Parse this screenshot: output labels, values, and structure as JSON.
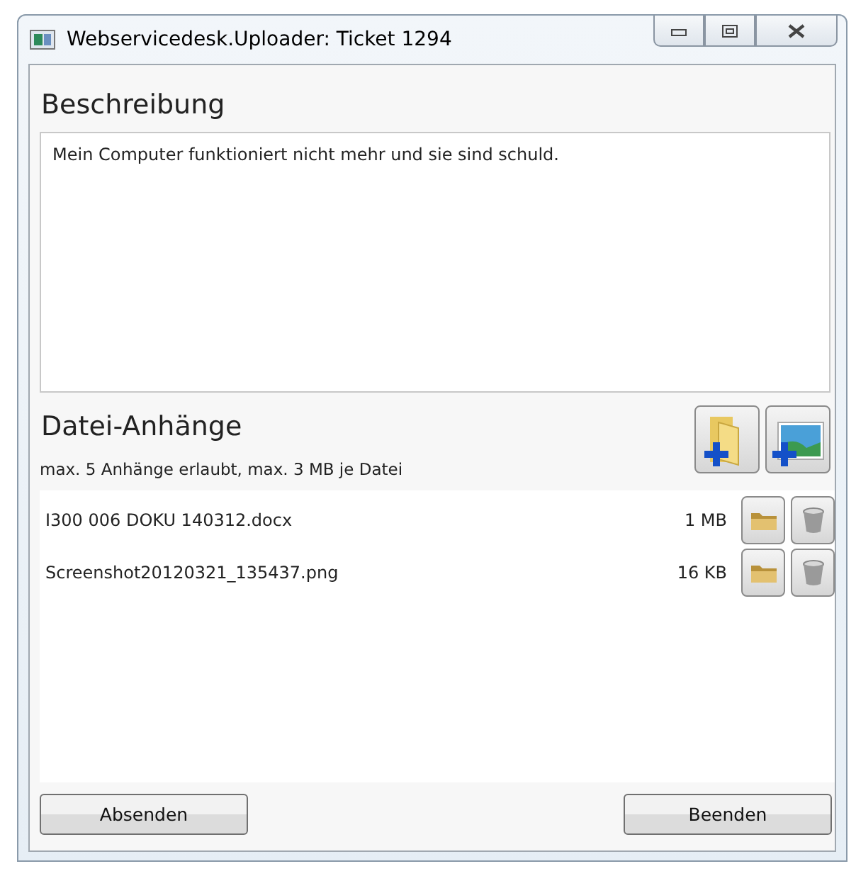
{
  "window": {
    "title": "Webservicedesk.Uploader: Ticket 1294"
  },
  "description": {
    "heading": "Beschreibung",
    "value": "Mein Computer funktioniert nicht mehr und sie sind schuld."
  },
  "attachments": {
    "heading": "Datei-Anhänge",
    "hint": "max. 5 Anhänge erlaubt, max. 3 MB je Datei",
    "files": [
      {
        "name": "I300 006 DOKU 140312.docx",
        "size": "1 MB"
      },
      {
        "name": "Screenshot20120321_135437.png",
        "size": "16 KB"
      }
    ]
  },
  "buttons": [
    {
      "label": "Absenden"
    },
    {
      "label": "Beenden"
    }
  ]
}
